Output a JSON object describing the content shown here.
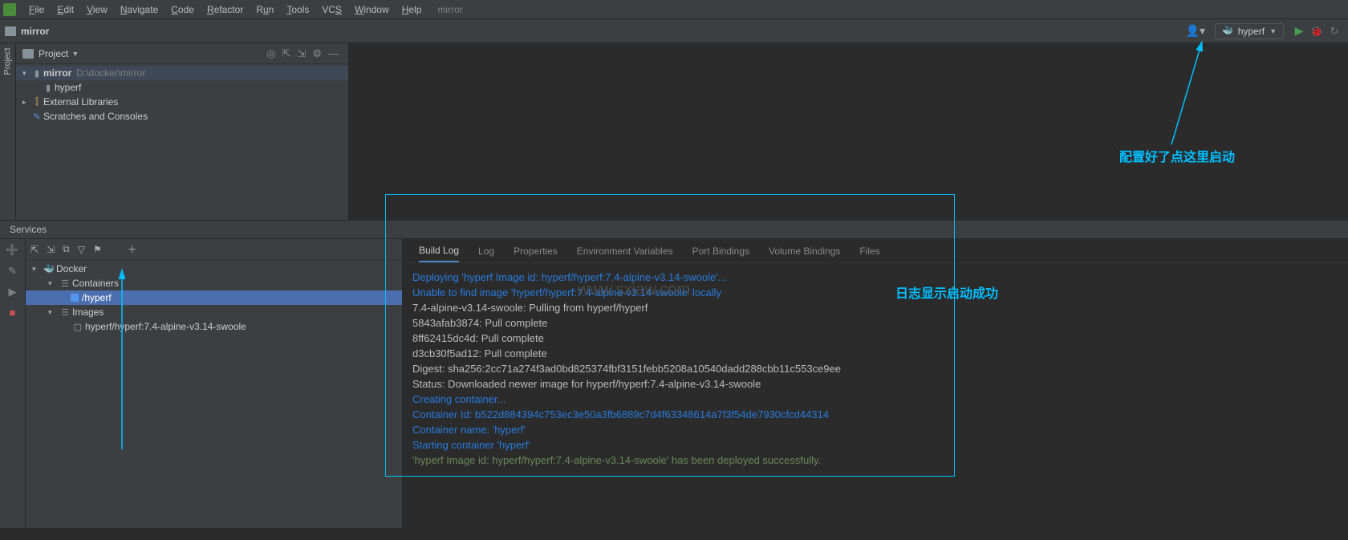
{
  "menu": {
    "items": [
      "File",
      "Edit",
      "View",
      "Navigate",
      "Code",
      "Refactor",
      "Run",
      "Tools",
      "VCS",
      "Window",
      "Help"
    ],
    "context": "mirror"
  },
  "nav": {
    "project_name": "mirror",
    "run_config_label": "hyperf"
  },
  "project_panel": {
    "title": "Project",
    "root": {
      "name": "mirror",
      "path": "D:\\docker\\mirror"
    },
    "child_folder": "hyperf",
    "external": "External Libraries",
    "scratches": "Scratches and Consoles"
  },
  "services": {
    "title": "Services",
    "tree": {
      "root": "Docker",
      "containers": "Containers",
      "container_item": "/hyperf",
      "images": "Images",
      "image_item": "hyperf/hyperf:7.4-alpine-v3.14-swoole"
    },
    "tabs": [
      "Build Log",
      "Log",
      "Properties",
      "Environment Variables",
      "Port Bindings",
      "Volume Bindings",
      "Files"
    ],
    "active_tab": 0,
    "log": [
      {
        "cls": "blue",
        "text": "Deploying 'hyperf Image id: hyperf/hyperf:7.4-alpine-v3.14-swoole'..."
      },
      {
        "cls": "blue",
        "text": "Unable to find image 'hyperf/hyperf:7.4-alpine-v3.14-swoole' locally"
      },
      {
        "cls": "gray",
        "text": "7.4-alpine-v3.14-swoole: Pulling from hyperf/hyperf"
      },
      {
        "cls": "gray",
        "text": "5843afab3874: Pull complete"
      },
      {
        "cls": "gray",
        "text": "8ff62415dc4d: Pull complete"
      },
      {
        "cls": "gray",
        "text": "d3cb30f5ad12: Pull complete"
      },
      {
        "cls": "gray",
        "text": "Digest: sha256:2cc71a274f3ad0bd825374fbf3151febb5208a10540dadd288cbb11c553ce9ee"
      },
      {
        "cls": "gray",
        "text": "Status: Downloaded newer image for hyperf/hyperf:7.4-alpine-v3.14-swoole"
      },
      {
        "cls": "blue",
        "text": "Creating container..."
      },
      {
        "cls": "blue",
        "text": "Container Id: b522d884394c753ec3e50a3fb6889c7d4f63348614a7f3f54de7930cfcd44314"
      },
      {
        "cls": "blue",
        "text": "Container name: 'hyperf'"
      },
      {
        "cls": "blue",
        "text": "Starting container 'hyperf'"
      },
      {
        "cls": "green",
        "text": "'hyperf Image id: hyperf/hyperf:7.4-alpine-v3.14-swoole' has been deployed successfully."
      }
    ]
  },
  "annotations": {
    "top_right": "配置好了点这里启动",
    "log_label": "日志显示启动成功"
  },
  "watermark": "www.sxiaw.com"
}
